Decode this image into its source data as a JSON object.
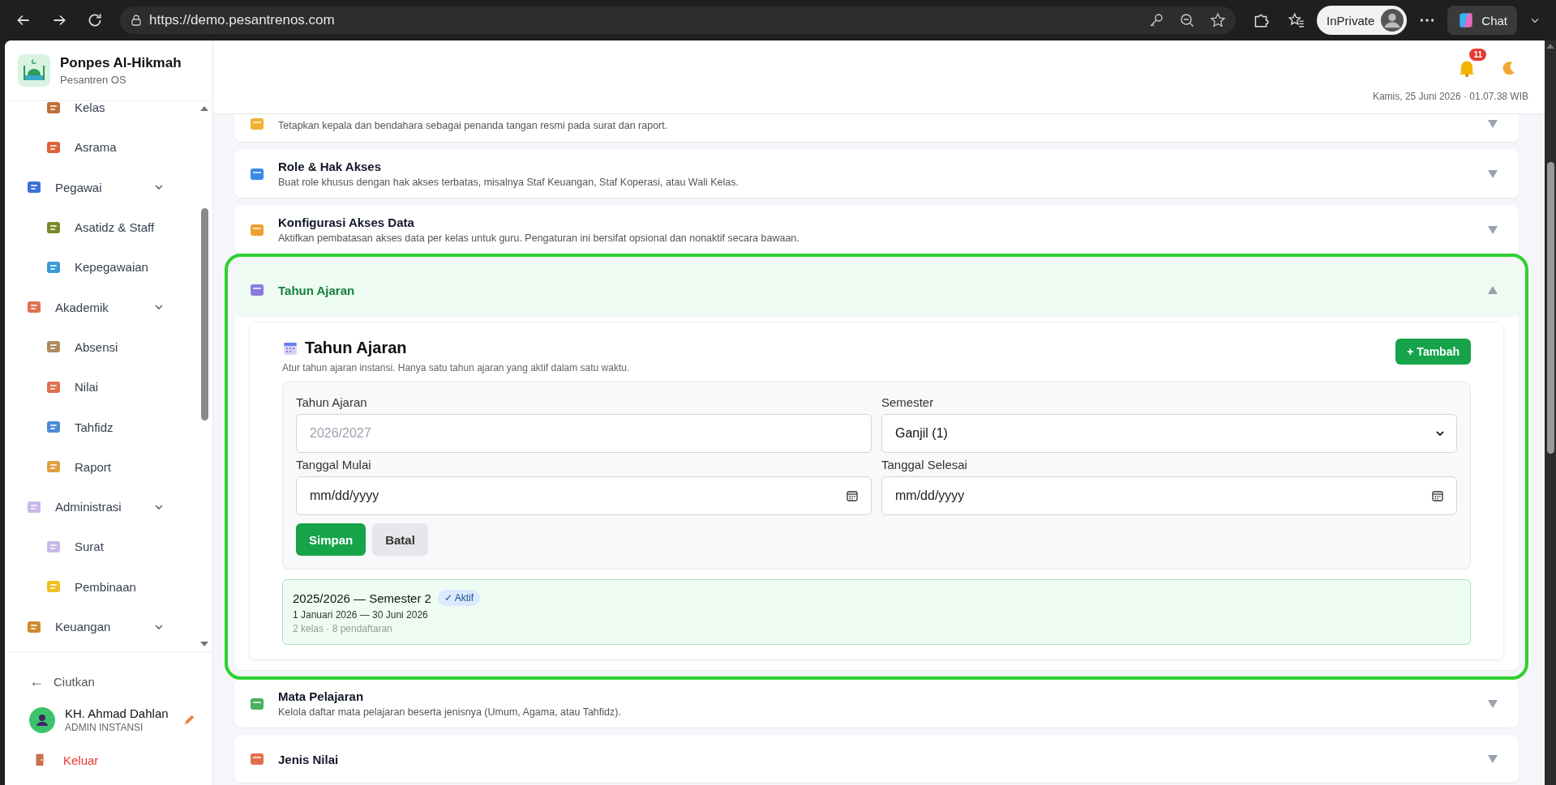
{
  "browser": {
    "url": "https://demo.pesantrenos.com",
    "profile_label": "InPrivate",
    "chat_label": "Chat"
  },
  "sidebar": {
    "app_name": "Ponpes Al-Hikmah",
    "app_subtitle": "Pesantren OS",
    "items": [
      {
        "label": "Kelas",
        "kind": "child"
      },
      {
        "label": "Asrama",
        "kind": "child"
      },
      {
        "label": "Pegawai",
        "kind": "group",
        "expanded": true
      },
      {
        "label": "Asatidz & Staff",
        "kind": "child"
      },
      {
        "label": "Kepegawaian",
        "kind": "child"
      },
      {
        "label": "Akademik",
        "kind": "group",
        "expanded": true
      },
      {
        "label": "Absensi",
        "kind": "child"
      },
      {
        "label": "Nilai",
        "kind": "child"
      },
      {
        "label": "Tahfidz",
        "kind": "child"
      },
      {
        "label": "Raport",
        "kind": "child"
      },
      {
        "label": "Administrasi",
        "kind": "group",
        "expanded": true
      },
      {
        "label": "Surat",
        "kind": "child"
      },
      {
        "label": "Pembinaan",
        "kind": "child"
      },
      {
        "label": "Keuangan",
        "kind": "group",
        "expanded": true
      }
    ],
    "collapse": {
      "arrow": "←",
      "label": "Ciutkan"
    },
    "user": {
      "name": "KH. Ahmad Dahlan",
      "role": "ADMIN INSTANSI"
    },
    "logout": "Keluar"
  },
  "header": {
    "notification_count": "11",
    "datetime": "Kamis, 25 Juni 2026 · 01.07.38 WIB"
  },
  "sections": [
    {
      "description": "Tetapkan kepala dan bendahara sebagai penanda tangan resmi pada surat dan raport.",
      "expanded": false
    },
    {
      "title": "Role & Hak Akses",
      "description": "Buat role khusus dengan hak akses terbatas, misalnya Staf Keuangan, Staf Koperasi, atau Wali Kelas.",
      "expanded": false
    },
    {
      "title": "Konfigurasi Akses Data",
      "description": "Aktifkan pembatasan akses data per kelas untuk guru. Pengaturan ini bersifat opsional dan nonaktif secara bawaan.",
      "expanded": false
    },
    {
      "title": "Tahun Ajaran",
      "expanded": true,
      "panel": {
        "title": "Tahun Ajaran",
        "subtitle": "Atur tahun ajaran instansi. Hanya satu tahun ajaran yang aktif dalam satu waktu.",
        "add_button": "+ Tambah",
        "fields": [
          {
            "label": "Tahun Ajaran",
            "kind": "text",
            "placeholder": "2026/2027"
          },
          {
            "label": "Semester",
            "kind": "select",
            "value": "Ganjil (1)"
          },
          {
            "label": "Tanggal Mulai",
            "kind": "date",
            "placeholder": "mm/dd/yyyy"
          },
          {
            "label": "Tanggal Selesai",
            "kind": "date",
            "placeholder": "mm/dd/yyyy"
          }
        ],
        "save_button": "Simpan",
        "cancel_button": "Batal",
        "years": [
          {
            "title": "2025/2026 — Semester 2",
            "badge": "✓ Aktif",
            "active": true,
            "dates": "1 Januari 2026 — 30 Juni 2026",
            "stats": "2 kelas · 8 pendaftaran"
          }
        ]
      }
    },
    {
      "title": "Mata Pelajaran",
      "description": "Kelola daftar mata pelajaran beserta jenisnya (Umum, Agama, atau Tahfidz).",
      "expanded": false
    },
    {
      "title": "Jenis Nilai",
      "expanded": false
    }
  ]
}
